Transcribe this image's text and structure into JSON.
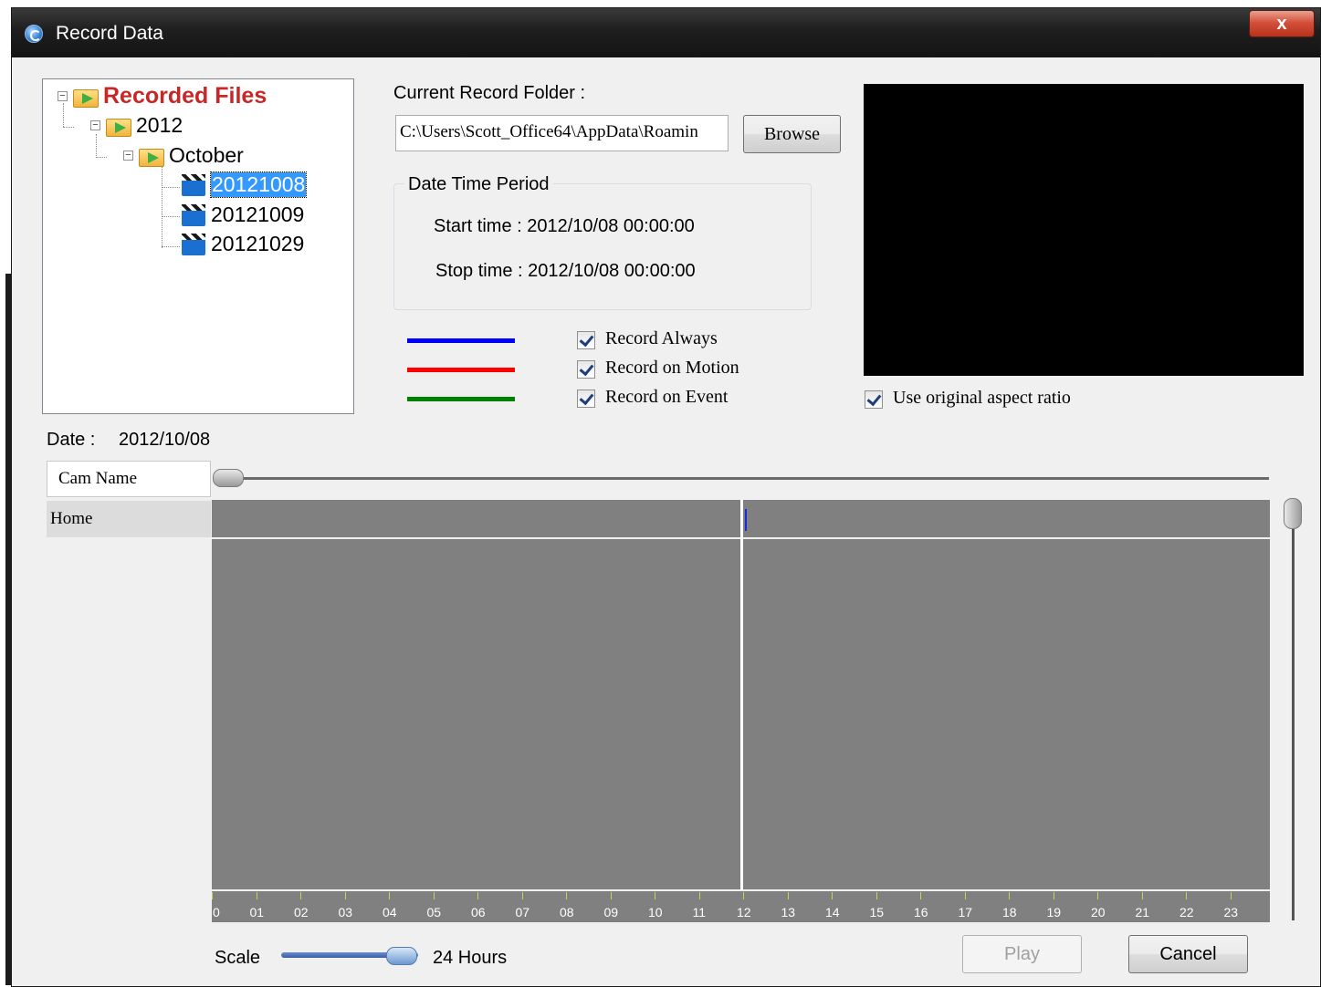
{
  "window": {
    "title": "Record Data",
    "close_label": "x"
  },
  "tree": {
    "root_label": "Recorded Files",
    "year_label": "2012",
    "month_label": "October",
    "days": [
      "20121008",
      "20121009",
      "20121029"
    ],
    "selected_day": "20121008",
    "expander_symbol": "−"
  },
  "record_folder": {
    "label": "Current Record Folder :",
    "path": "C:\\Users\\Scott_Office64\\AppData\\Roamin",
    "browse_label": "Browse"
  },
  "period": {
    "title": "Date Time Period",
    "start": "Start time : 2012/10/08 00:00:00",
    "stop": "Stop time : 2012/10/08 00:00:00"
  },
  "legend": [
    {
      "label": "Record Always",
      "color": "#0000ff",
      "checked": true
    },
    {
      "label": "Record on Motion",
      "color": "#ff0000",
      "checked": true
    },
    {
      "label": "Record on Event",
      "color": "#008000",
      "checked": true
    }
  ],
  "aspect": {
    "label": "Use original aspect ratio",
    "checked": true
  },
  "date": {
    "label": "Date :",
    "value": "2012/10/08"
  },
  "grid": {
    "header": "Cam Name",
    "cameras": [
      "Home"
    ]
  },
  "timeline": {
    "hour_labels": [
      "0",
      "01",
      "02",
      "03",
      "04",
      "05",
      "06",
      "07",
      "08",
      "09",
      "10",
      "11",
      "12",
      "13",
      "14",
      "15",
      "16",
      "17",
      "18",
      "19",
      "20",
      "21",
      "22",
      "23"
    ],
    "cursor_hour": 12,
    "background": "#808080"
  },
  "scale": {
    "label": "Scale",
    "value": "24 Hours",
    "level": 1.0
  },
  "buttons": {
    "play_label": "Play",
    "cancel_label": "Cancel"
  }
}
